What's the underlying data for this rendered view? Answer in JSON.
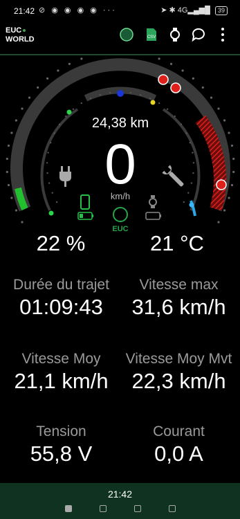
{
  "status_bar": {
    "time": "21:42",
    "left_icons": "⊘ ◉ ◉ ◉ ◉ ···",
    "right_icons": "➤ ✱ 4G▂▄▆█",
    "battery": "39"
  },
  "app_bar": {
    "logo_line1": "EUC",
    "logo_line2": "WORLD",
    "csv_label": "CSV"
  },
  "gauge": {
    "distance": "24,38 km",
    "speed": "0",
    "speed_unit": "km/h",
    "battery_percent": "22 %",
    "temperature": "21 °C",
    "euc_label": "EUC",
    "colors": {
      "arc": "#3a3a3a",
      "battery_fill": "#22c02e",
      "danger": "#e0201a",
      "accent_green": "#27a54a"
    }
  },
  "stats": [
    {
      "label": "Durée du trajet",
      "value": "01:09:43"
    },
    {
      "label": "Vitesse max",
      "value": "31,6 km/h"
    },
    {
      "label": "Vitesse Moy",
      "value": "21,1 km/h"
    },
    {
      "label": "Vitesse Moy Mvt",
      "value": "22,3 km/h"
    },
    {
      "label": "Tension",
      "value": "55,8 V"
    },
    {
      "label": "Courant",
      "value": "0,0 A"
    }
  ],
  "bottom_bar": {
    "time": "21:42"
  }
}
